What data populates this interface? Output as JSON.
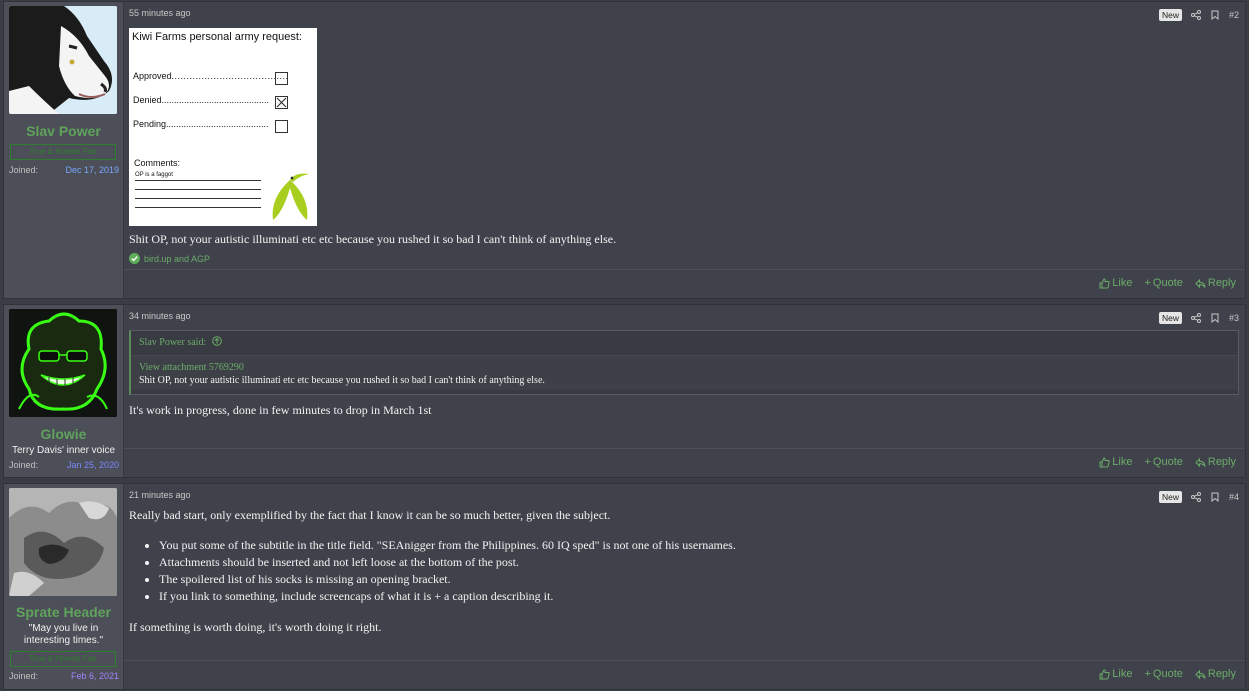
{
  "posts": [
    {
      "user": {
        "name": "Slav Power",
        "banner": "True & Honest Fan",
        "joined_label": "Joined:",
        "joined_date": "Dec 17, 2019"
      },
      "time": "55 minutes ago",
      "new_badge": "New",
      "number": "#2",
      "attachment": {
        "title": "Kiwi Farms personal army request:",
        "rows": [
          {
            "label": "Approved",
            "state": "unchecked"
          },
          {
            "label": "Denied",
            "state": "crossed"
          },
          {
            "label": "Pending",
            "state": "unchecked"
          }
        ],
        "comments_label": "Comments:",
        "comment": "OP is a faggot"
      },
      "text": "Shit OP, not your autistic illuminati etc etc because you rushed it so bad I can't think of anything else.",
      "reaction": "bird.up and AGP",
      "footer": {
        "like": "Like",
        "quote": "Quote",
        "reply": "Reply"
      }
    },
    {
      "user": {
        "name": "Glowie",
        "title": "Terry Davis' inner voice",
        "joined_label": "Joined:",
        "joined_date": "Jan 25, 2020"
      },
      "time": "34 minutes ago",
      "new_badge": "New",
      "number": "#3",
      "quote": {
        "author": "Slav Power said:",
        "link": "View attachment 5769290",
        "text": "Shit OP, not your autistic illuminati etc etc because you rushed it so bad I can't think of anything else."
      },
      "text": "It's work in progress, done in few minutes to drop in March 1st",
      "footer": {
        "like": "Like",
        "quote": "Quote",
        "reply": "Reply"
      }
    },
    {
      "user": {
        "name": "Sprate Header",
        "title_line1": "\"May you live in",
        "title_line2": "interesting times.\"",
        "banner": "True & Honest Fan",
        "joined_label": "Joined:",
        "joined_date": "Feb 6, 2021"
      },
      "time": "21 minutes ago",
      "new_badge": "New",
      "number": "#4",
      "text_intro": "Really bad start, only exemplified by the fact that I know it can be so much better, given the subject.",
      "list": [
        "You put some of the subtitle in the title field. \"SEAnigger from the Philippines. 60 IQ sped\" is not one of his usernames.",
        "Attachments should be inserted and not left loose at the bottom of the post.",
        "The spoilered list of his socks is missing an opening bracket.",
        "If you link to something, include screencaps of what it is + a caption describing it."
      ],
      "text_outro": "If something is worth doing, it's worth doing it right.",
      "footer": {
        "like": "Like",
        "quote": "Quote",
        "reply": "Reply"
      }
    }
  ],
  "colors": {
    "green": "#6cab6a",
    "username_green": "#5fa35c",
    "date_blue": "#7aa7ff",
    "date_purple": "#a483ff"
  }
}
